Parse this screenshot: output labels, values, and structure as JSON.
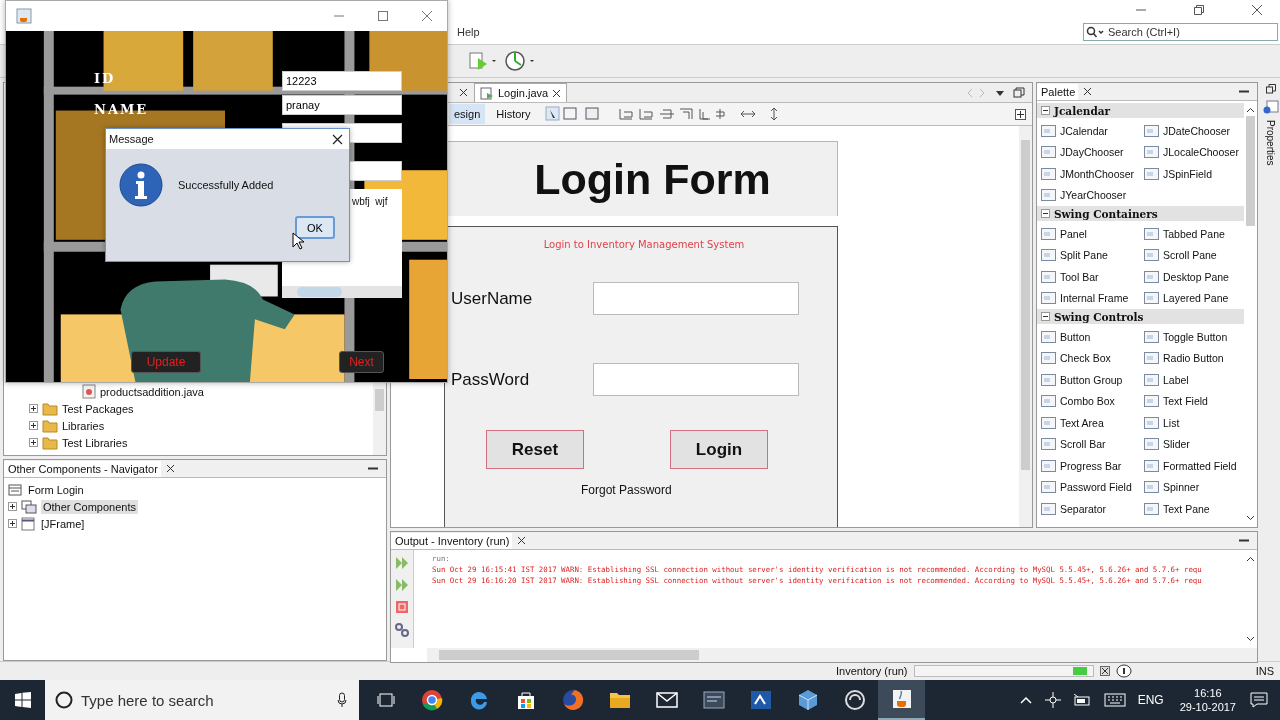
{
  "ide": {
    "menu": [
      "Help"
    ],
    "search": {
      "placeholder": "Search (Ctrl+I)"
    }
  },
  "project_tree": [
    {
      "label": "productsaddition.java",
      "kind": "file"
    },
    {
      "label": "Test Packages",
      "kind": "folder",
      "expanded": false
    },
    {
      "label": "Libraries",
      "kind": "folder",
      "expanded": false
    },
    {
      "label": "Test Libraries",
      "kind": "folder",
      "expanded": false
    }
  ],
  "navigator": {
    "title": "Other Components - Navigator",
    "items": [
      {
        "label": "Form Login",
        "kind": "form",
        "selected": false
      },
      {
        "label": "Other Components",
        "kind": "group",
        "expanded": false,
        "selected": true
      },
      {
        "label": "[JFrame]",
        "kind": "frame",
        "expanded": false,
        "selected": false
      }
    ]
  },
  "editor": {
    "tabs": [
      {
        "label": "Login.java",
        "selected": true
      }
    ],
    "view_tabs": [
      {
        "label": "esign",
        "selected": true
      },
      {
        "label": "History",
        "selected": false
      }
    ],
    "form": {
      "title": "Login Form",
      "subtitle": "Login to Inventory Management System",
      "fields": [
        {
          "label": "UserName"
        },
        {
          "label": "PassWord"
        }
      ],
      "buttons": [
        "Reset",
        "Login"
      ],
      "link": "Forgot Password"
    }
  },
  "output": {
    "title": "Output - Inventory (run)",
    "lines": [
      {
        "text": "run:",
        "kind": "info"
      },
      {
        "text": "Sun Oct 29 16:15:41 IST 2017 WARN: Establishing SSL connection without server's identity verification is not recommended. According to MySQL 5.5.45+, 5.6.26+ and 5.7.6+ requ",
        "kind": "warn"
      },
      {
        "text": "Sun Oct 29 16:16:20 IST 2017 WARN: Establishing SSL connection without server's identity verification is not recommended. According to MySQL 5.5.45+, 5.6.26+ and 5.7.6+ requ",
        "kind": "warn"
      }
    ]
  },
  "palette": {
    "title": "Palette",
    "categories": [
      {
        "name": "Jcalendar",
        "expanded": true,
        "items": [
          "JCalendar",
          "JDateChooser",
          "JDayChooser",
          "JLocaleChooser",
          "JMonthChooser",
          "JSpinField",
          "JYearChooser"
        ]
      },
      {
        "name": "Swing Containers",
        "expanded": true,
        "items": [
          "Panel",
          "Tabbed Pane",
          "Split Pane",
          "Scroll Pane",
          "Tool Bar",
          "Desktop Pane",
          "Internal Frame",
          "Layered Pane"
        ]
      },
      {
        "name": "Swing Controls",
        "expanded": true,
        "items": [
          "Button",
          "Toggle Button",
          "Check Box",
          "Radio Button",
          "Button Group",
          "Label",
          "Combo Box",
          "Text Field",
          "Text Area",
          "List",
          "Scroll Bar",
          "Slider",
          "Progress Bar",
          "Formatted Field",
          "Password Field",
          "Spinner",
          "Separator",
          "Text Pane"
        ]
      }
    ]
  },
  "properties_label": "Properties",
  "status_bar": {
    "task": "Inventory (run)",
    "mode": "INS"
  },
  "app_window": {
    "fields": [
      {
        "label": "ID",
        "value": "12223"
      },
      {
        "label": "NAME",
        "value": "pranay"
      }
    ],
    "text_area": "wbfj  wjf",
    "buttons": [
      "Update",
      "Next"
    ]
  },
  "dialog": {
    "title": "Message",
    "message": "Successfully Added",
    "button": {
      "label": "OK",
      "focused": true
    }
  },
  "taskbar": {
    "search_placeholder": "Type here to search",
    "language": "ENG",
    "time": "16:16",
    "date": "29-10-2017"
  }
}
